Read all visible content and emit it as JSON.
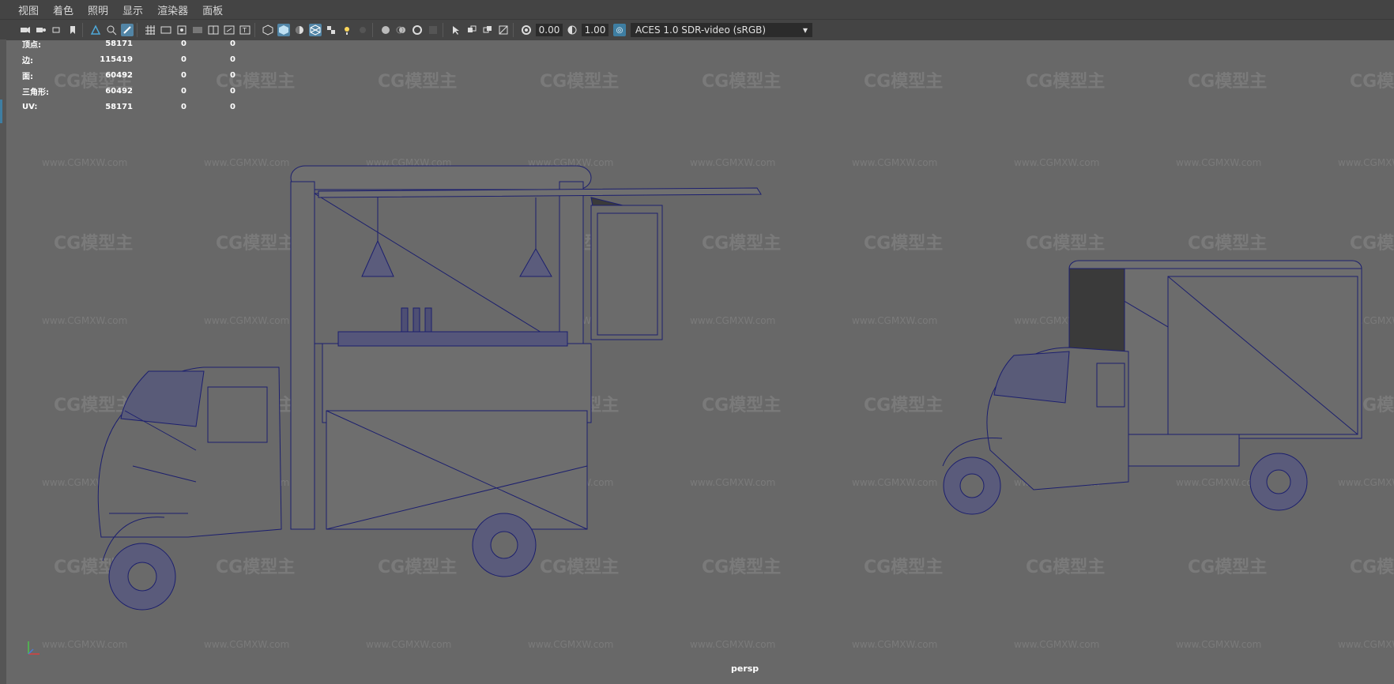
{
  "menu": {
    "items": [
      "视图",
      "着色",
      "照明",
      "显示",
      "渲染器",
      "面板"
    ]
  },
  "toolbar": {
    "exposure": "0.00",
    "gamma": "1.00",
    "color_space": "ACES 1.0 SDR-video (sRGB)",
    "accent": "#5285a6"
  },
  "hud": {
    "rows": [
      {
        "label": "顶点:",
        "v1": "58171",
        "v2": "0",
        "v3": "0"
      },
      {
        "label": "边:",
        "v1": "115419",
        "v2": "0",
        "v3": "0"
      },
      {
        "label": "面:",
        "v1": "60492",
        "v2": "0",
        "v3": "0"
      },
      {
        "label": "三角形:",
        "v1": "60492",
        "v2": "0",
        "v3": "0"
      },
      {
        "label": "UV:",
        "v1": "58171",
        "v2": "0",
        "v3": "0"
      }
    ]
  },
  "viewport": {
    "camera": "persp",
    "background": "#686868",
    "wire_color": "#1c1f6e",
    "axis_labels": [
      "y",
      "z",
      "x"
    ]
  },
  "watermark": {
    "logo": "CG模型主",
    "url": "www.CGMXW.com"
  }
}
